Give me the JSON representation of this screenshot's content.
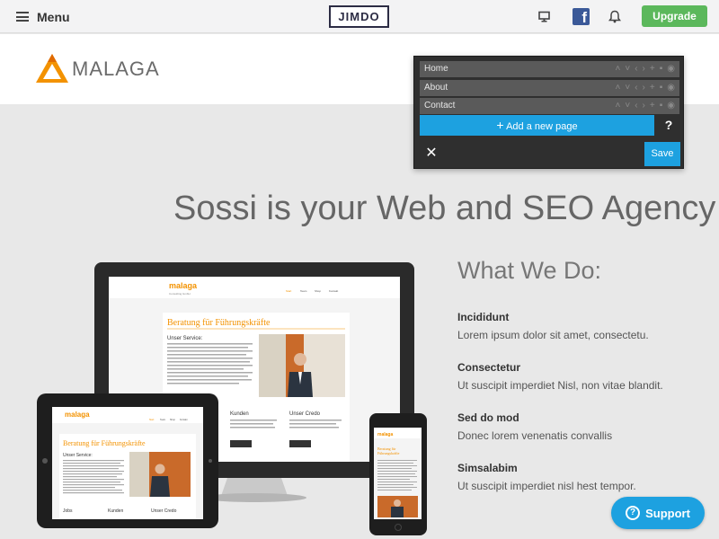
{
  "topbar": {
    "menu_label": "Menu",
    "logo_text": "JIMDO",
    "upgrade_label": "Upgrade",
    "icons": {
      "menu": "hamburger-icon",
      "preview": "monitor-icon",
      "facebook": "facebook-icon",
      "notifications": "bell-icon"
    },
    "accent": "#5cb85c"
  },
  "site": {
    "logo_text": "MALAGA",
    "brand_color": "#f39200"
  },
  "nav_editor": {
    "pages": [
      {
        "label": "Home"
      },
      {
        "label": "About"
      },
      {
        "label": "Contact"
      }
    ],
    "add_page_label": "Add a new page",
    "help_label": "?",
    "close_label": "✕",
    "save_label": "Save",
    "accent": "#1da1e0"
  },
  "main": {
    "headline": "Sossi is your Web and SEO Agency",
    "section_title": "What We Do:",
    "services": [
      {
        "title": "Incididunt",
        "desc": "Lorem ipsum dolor sit amet, consectetu."
      },
      {
        "title": "Consectetur",
        "desc": "Ut suscipit imperdiet Nisl, non vitae blandit."
      },
      {
        "title": "Sed do mod",
        "desc": "Donec lorem venenatis convallis"
      },
      {
        "title": "Simsalabim",
        "desc": "Ut suscipit imperdiet nisl hest tempor."
      }
    ]
  },
  "mockup": {
    "brand": "malaga",
    "heading": "Beratung für Führungskräfte",
    "subheading": "Unser Service:",
    "col1": "Kunden",
    "col2": "Unser Credo",
    "tablet_col0": "Jobs"
  },
  "support": {
    "label": "Support",
    "icon": "help-circle-icon"
  }
}
